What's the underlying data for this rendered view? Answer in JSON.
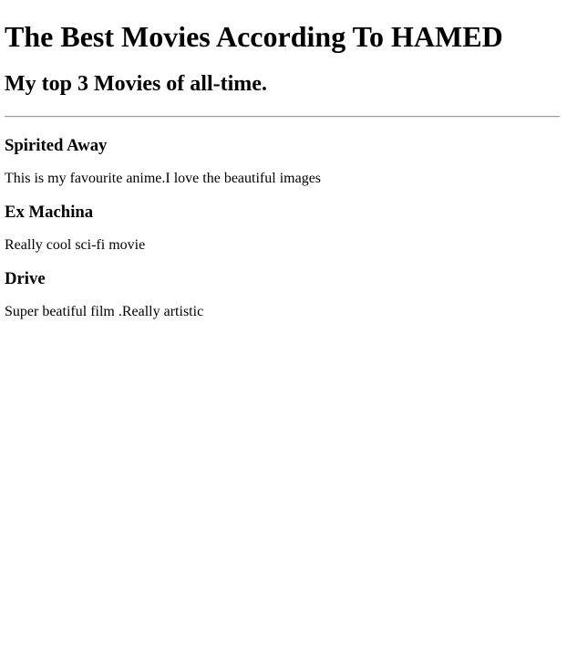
{
  "header": {
    "title": "The Best Movies According To HAMED",
    "subtitle": "My top 3 Movies of all-time."
  },
  "movies": [
    {
      "title": "Spirited Away",
      "description": "This is my favourite anime.I love the beautiful images"
    },
    {
      "title": "Ex Machina",
      "description": "Really cool sci-fi movie"
    },
    {
      "title": "Drive",
      "description": "Super beatiful film .Really artistic"
    }
  ]
}
